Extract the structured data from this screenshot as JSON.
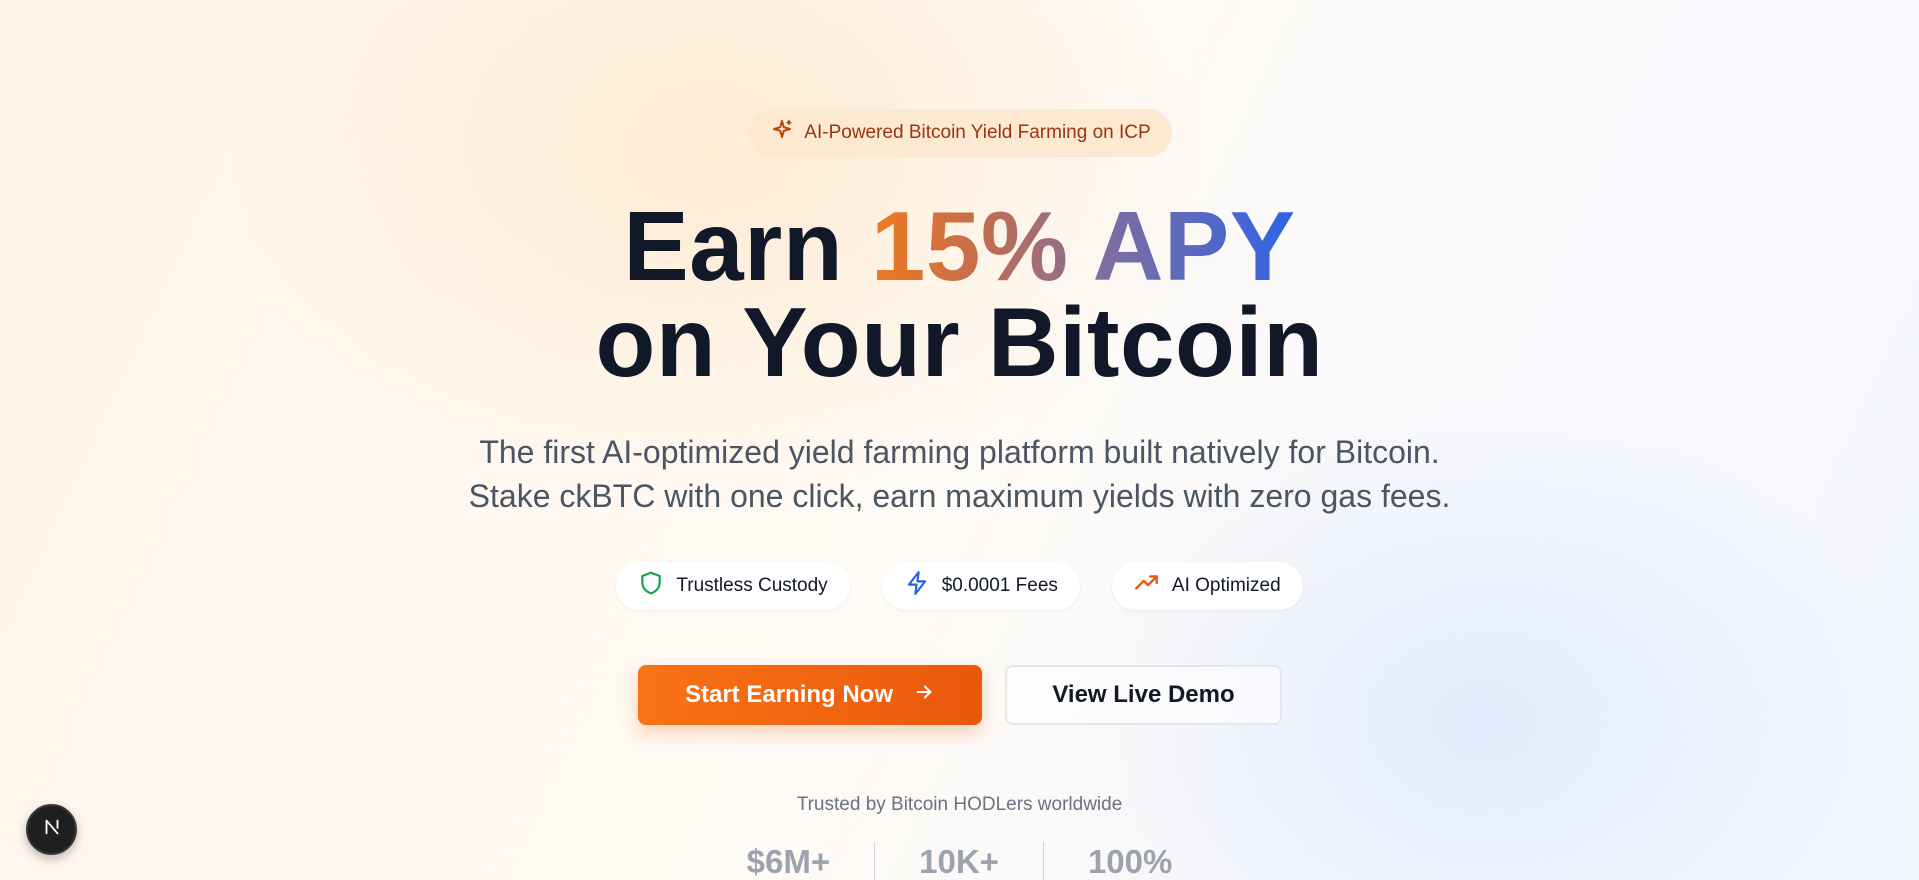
{
  "badge": {
    "label": "AI-Powered Bitcoin Yield Farming on ICP",
    "icon": "sparkles-icon"
  },
  "headline": {
    "line1_prefix": "Earn ",
    "line1_highlight": "15% APY",
    "line2": "on Your Bitcoin"
  },
  "subtitle": {
    "line1": "The first AI-optimized yield farming platform built natively for Bitcoin.",
    "line2": "Stake ckBTC with one click, earn maximum yields with zero gas fees."
  },
  "features": [
    {
      "label": "Trustless Custody",
      "icon": "shield-icon",
      "color": "#16a34a"
    },
    {
      "label": "$0.0001 Fees",
      "icon": "lightning-icon",
      "color": "#2563eb"
    },
    {
      "label": "AI Optimized",
      "icon": "trending-up-icon",
      "color": "#ea580c"
    }
  ],
  "cta": {
    "primary_label": "Start Earning Now",
    "secondary_label": "View Live Demo"
  },
  "trusted": {
    "label": "Trusted by Bitcoin HODLers worldwide",
    "stats": [
      "$6M+",
      "10K+",
      "100%"
    ]
  },
  "dev_indicator": {
    "letter": "N"
  },
  "colors": {
    "accent": "#f97316",
    "badge_bg": "#fde8d1",
    "headline": "#111827"
  }
}
